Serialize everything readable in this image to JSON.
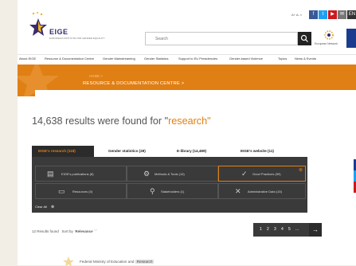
{
  "header": {
    "logo_text": "EIGE",
    "logo_sub": "EUROPEAN INSTITUTE FOR GENDER EQUALITY",
    "util_text": "A+ A- ◐",
    "social": [
      "f",
      "t",
      "▶",
      "✉",
      "EN"
    ],
    "search_placeholder": "Search",
    "partner_label": "European Network"
  },
  "nav": {
    "items": [
      "About EIGE",
      "Resource & Documentation Centre",
      "Gender Mainstreaming",
      "Gender Statistics",
      "Support to EU Presidencies",
      "Gender-based Violence",
      "Topics",
      "News & Events"
    ]
  },
  "breadcrumb": {
    "home": "HOME  >",
    "current": "RESOURCE & DOCUMENTATION CENTRE  >"
  },
  "results": {
    "prefix": "14,638 results were found for \"",
    "term": "research",
    "suffix": "\""
  },
  "tabs": [
    {
      "label": "EIGE's research (118)"
    },
    {
      "label": "Gender statistics (28)"
    },
    {
      "label": "E-library (14,489)"
    },
    {
      "label": "EIGE's website (11)"
    }
  ],
  "categories": [
    {
      "label": "EIGE's publications (8)",
      "icon": "book-icon"
    },
    {
      "label": "Methods & Tools (13)",
      "icon": "gears-icon"
    },
    {
      "label": "Good Practices (99)",
      "icon": "check-badge-icon"
    },
    {
      "label": "Resources (0)",
      "icon": "folder-icon"
    },
    {
      "label": "Stakeholders (1)",
      "icon": "person-icon"
    },
    {
      "label": "Administrative Data (15)",
      "icon": "tools-icon"
    }
  ],
  "clear_all": "Clear All",
  "listing": {
    "found": "12 Results found",
    "sort_label": "Sort by",
    "sort_value": "Relevance"
  },
  "pager": {
    "pages": [
      "1",
      "2",
      "3",
      "4",
      "5",
      "..."
    ],
    "next": "→"
  },
  "first_result": {
    "title": "Federal Ministry of Education and",
    "tag": "Research"
  },
  "colors": {
    "accent": "#e07f14",
    "dark": "#3a3a3a",
    "brand": "#3a2a6e"
  }
}
